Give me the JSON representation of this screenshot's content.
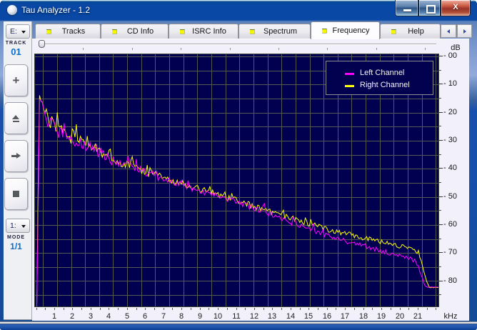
{
  "window": {
    "title": "Tau Analyzer - 1.2",
    "caption_buttons": {
      "minimize": "minimize",
      "maximize": "maximize",
      "close": "close"
    }
  },
  "tab_bar": {
    "tabs": [
      {
        "label": "Tracks",
        "active": false
      },
      {
        "label": "CD Info",
        "active": false
      },
      {
        "label": "ISRC Info",
        "active": false
      },
      {
        "label": "Spectrum",
        "active": false
      },
      {
        "label": "Frequency",
        "active": true
      },
      {
        "label": "Help",
        "active": false
      }
    ],
    "led_color": "#f3f800",
    "scroll_buttons": [
      "scroll-left",
      "scroll-right"
    ]
  },
  "sidebar": {
    "drive_combo_value": "E:",
    "track_caption": "TRACK",
    "track_number": "01",
    "transport_buttons": [
      "add",
      "eject",
      "next",
      "stop"
    ],
    "mode_combo_value": "1:",
    "mode_caption": "MODE",
    "mode_value": "1/1"
  },
  "chart_data": {
    "type": "line",
    "x_unit": "kHz",
    "y_unit": "dB",
    "x_ticks": [
      1,
      2,
      3,
      4,
      5,
      6,
      7,
      8,
      9,
      10,
      11,
      12,
      13,
      14,
      15,
      16,
      17,
      18,
      19,
      20,
      21
    ],
    "y_ticks": [
      "00",
      "10",
      "20",
      "30",
      "40",
      "50",
      "60",
      "70",
      "80"
    ],
    "x_range_khz": [
      0,
      22.15
    ],
    "y_range_db_attenuation": [
      0,
      90.5
    ],
    "grid": true,
    "background": "#010050",
    "grid_color": "#555a50",
    "legend": [
      {
        "name": "Left Channel",
        "color": "#ff00ff"
      },
      {
        "name": "Right Channel",
        "color": "#ffff00"
      }
    ],
    "series": [
      {
        "name": "Right Channel",
        "color": "#ffff00",
        "anchors_khz_db": [
          [
            0,
            89.5
          ],
          [
            0.075,
            45
          ],
          [
            0.15,
            11.8
          ],
          [
            0.25,
            16
          ],
          [
            0.4,
            19
          ],
          [
            0.6,
            21.5
          ],
          [
            0.8,
            23.5
          ],
          [
            1,
            25.2
          ],
          [
            1.3,
            26.8
          ],
          [
            1.6,
            28
          ],
          [
            2,
            29.2
          ],
          [
            2.5,
            30.6
          ],
          [
            3,
            32
          ],
          [
            3.5,
            34
          ],
          [
            4,
            36
          ],
          [
            4.5,
            37.6
          ],
          [
            5,
            38.8
          ],
          [
            6,
            41.3
          ],
          [
            7,
            43.3
          ],
          [
            8,
            45.3
          ],
          [
            9,
            47.3
          ],
          [
            10,
            49.3
          ],
          [
            11,
            51.3
          ],
          [
            12,
            53.6
          ],
          [
            13,
            55.6
          ],
          [
            14,
            57.6
          ],
          [
            15,
            59.6
          ],
          [
            16,
            61.6
          ],
          [
            17,
            63.1
          ],
          [
            18,
            64.6
          ],
          [
            19,
            66.1
          ],
          [
            20,
            67.6
          ],
          [
            20.6,
            68.2
          ],
          [
            21,
            69.8
          ],
          [
            21.2,
            74
          ],
          [
            21.45,
            80
          ],
          [
            21.6,
            82.3
          ],
          [
            22.15,
            82.3
          ]
        ],
        "noise": {
          "seed": 1337,
          "base": 3.0,
          "decay": 0.3,
          "floor": 0.42
        }
      },
      {
        "name": "Left Channel",
        "color": "#ff00ff",
        "anchors_khz_db": [
          [
            0,
            89.5
          ],
          [
            0.075,
            55
          ],
          [
            0.15,
            12.6
          ],
          [
            0.25,
            16.6
          ],
          [
            0.4,
            19.6
          ],
          [
            0.6,
            22.1
          ],
          [
            0.8,
            24.1
          ],
          [
            1,
            25.8
          ],
          [
            1.3,
            27.4
          ],
          [
            1.6,
            28.6
          ],
          [
            2,
            29.8
          ],
          [
            2.5,
            31.2
          ],
          [
            3,
            32.6
          ],
          [
            3.5,
            34.6
          ],
          [
            4,
            36.6
          ],
          [
            4.5,
            38.2
          ],
          [
            5,
            39.4
          ],
          [
            6,
            41.9
          ],
          [
            7,
            43.9
          ],
          [
            8,
            45.9
          ],
          [
            9,
            47.9
          ],
          [
            10,
            49.9
          ],
          [
            11,
            51.9
          ],
          [
            12,
            54.3
          ],
          [
            13,
            56.4
          ],
          [
            14,
            59.1
          ],
          [
            15,
            61.4
          ],
          [
            16,
            63.8
          ],
          [
            17,
            65.8
          ],
          [
            18,
            67.4
          ],
          [
            19,
            69.3
          ],
          [
            20,
            71.2
          ],
          [
            20.5,
            72
          ],
          [
            20.9,
            73.2
          ],
          [
            21.1,
            77
          ],
          [
            21.35,
            81.5
          ],
          [
            21.5,
            82.2
          ],
          [
            22.15,
            82.2
          ]
        ],
        "noise": {
          "seed": 4242,
          "base": 2.8,
          "decay": 0.3,
          "floor": 0.4
        }
      }
    ]
  }
}
